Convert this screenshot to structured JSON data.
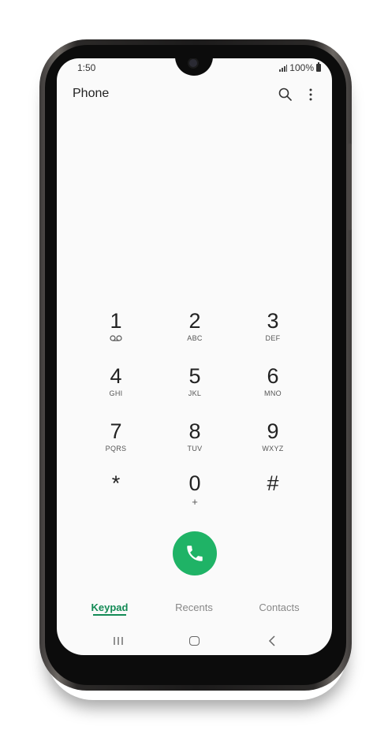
{
  "status_bar": {
    "time": "1:50",
    "battery": "100%",
    "signal_icon": "signal-icon",
    "battery_icon": "battery-icon"
  },
  "app_bar": {
    "title": "Phone",
    "search_icon": "search-icon",
    "more_icon": "more-options-icon"
  },
  "keypad": {
    "keys": [
      {
        "digit": "1",
        "letters": "",
        "extra": "voicemail-icon"
      },
      {
        "digit": "2",
        "letters": "ABC"
      },
      {
        "digit": "3",
        "letters": "DEF"
      },
      {
        "digit": "4",
        "letters": "GHI"
      },
      {
        "digit": "5",
        "letters": "JKL"
      },
      {
        "digit": "6",
        "letters": "MNO"
      },
      {
        "digit": "7",
        "letters": "PQRS"
      },
      {
        "digit": "8",
        "letters": "TUV"
      },
      {
        "digit": "9",
        "letters": "WXYZ"
      },
      {
        "digit": "*",
        "letters": ""
      },
      {
        "digit": "0",
        "letters": "+"
      },
      {
        "digit": "#",
        "letters": ""
      }
    ]
  },
  "call_button": {
    "icon": "phone-icon",
    "color": "#1fb366"
  },
  "tabs": [
    {
      "label": "Keypad",
      "active": true
    },
    {
      "label": "Recents",
      "active": false
    },
    {
      "label": "Contacts",
      "active": false
    }
  ],
  "nav_bar": {
    "recents_icon": "recent-apps-icon",
    "home_icon": "home-icon",
    "back_icon": "back-icon"
  },
  "colors": {
    "accent": "#138a55",
    "call_green": "#1fb366",
    "screen_bg": "#fafafa"
  }
}
